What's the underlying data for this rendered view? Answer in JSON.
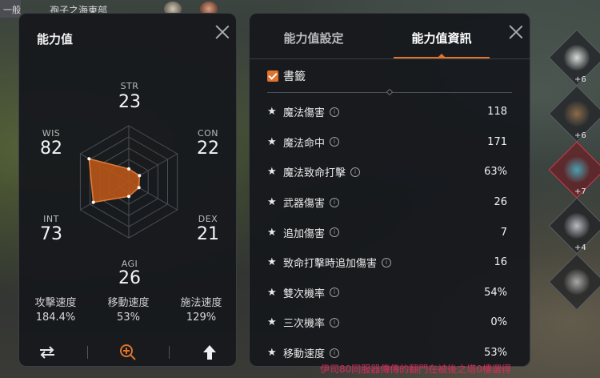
{
  "topbar": {
    "mode": "一般",
    "location": "孢子之海東部"
  },
  "stats_panel": {
    "title": "能力值",
    "radar": {
      "STR": {
        "label": "STR",
        "value": "23"
      },
      "CON": {
        "label": "CON",
        "value": "22"
      },
      "DEX": {
        "label": "DEX",
        "value": "21"
      },
      "AGI": {
        "label": "AGI",
        "value": "26"
      },
      "INT": {
        "label": "INT",
        "value": "73"
      },
      "WIS": {
        "label": "WIS",
        "value": "82"
      }
    },
    "speeds": [
      {
        "label": "攻擊速度",
        "value": "184.4%"
      },
      {
        "label": "移動速度",
        "value": "53%"
      },
      {
        "label": "施法速度",
        "value": "129%"
      }
    ]
  },
  "info_panel": {
    "tabs": [
      {
        "label": "能力值設定"
      },
      {
        "label": "能力值資訊"
      }
    ],
    "active_tab": 1,
    "bookmark_label": "書籤",
    "rows": [
      {
        "name": "魔法傷害",
        "value": "118"
      },
      {
        "name": "魔法命中",
        "value": "171"
      },
      {
        "name": "魔法致命打擊",
        "value": "63%"
      },
      {
        "name": "武器傷害",
        "value": "26"
      },
      {
        "name": "追加傷害",
        "value": "7"
      },
      {
        "name": "致命打擊時追加傷害",
        "value": "16"
      },
      {
        "name": "雙次機率",
        "value": "54%"
      },
      {
        "name": "三次機率",
        "value": "0%"
      },
      {
        "name": "移動速度",
        "value": "53%"
      }
    ]
  },
  "equipment": [
    {
      "icon": "armor-icon",
      "plus": "+6"
    },
    {
      "icon": "cloak-icon",
      "plus": "+6"
    },
    {
      "icon": "weapon-icon",
      "plus": "+7"
    },
    {
      "icon": "gauntlet-icon",
      "plus": "+4"
    },
    {
      "icon": "empty-slot-icon",
      "plus": ""
    }
  ],
  "ticker": "伊司80同服器傳傳的翻門在被後之塔0樓選得",
  "colors": {
    "accent": "#e0732c",
    "panel_bg": "#16181c",
    "radar_fill": "#b9561a"
  }
}
